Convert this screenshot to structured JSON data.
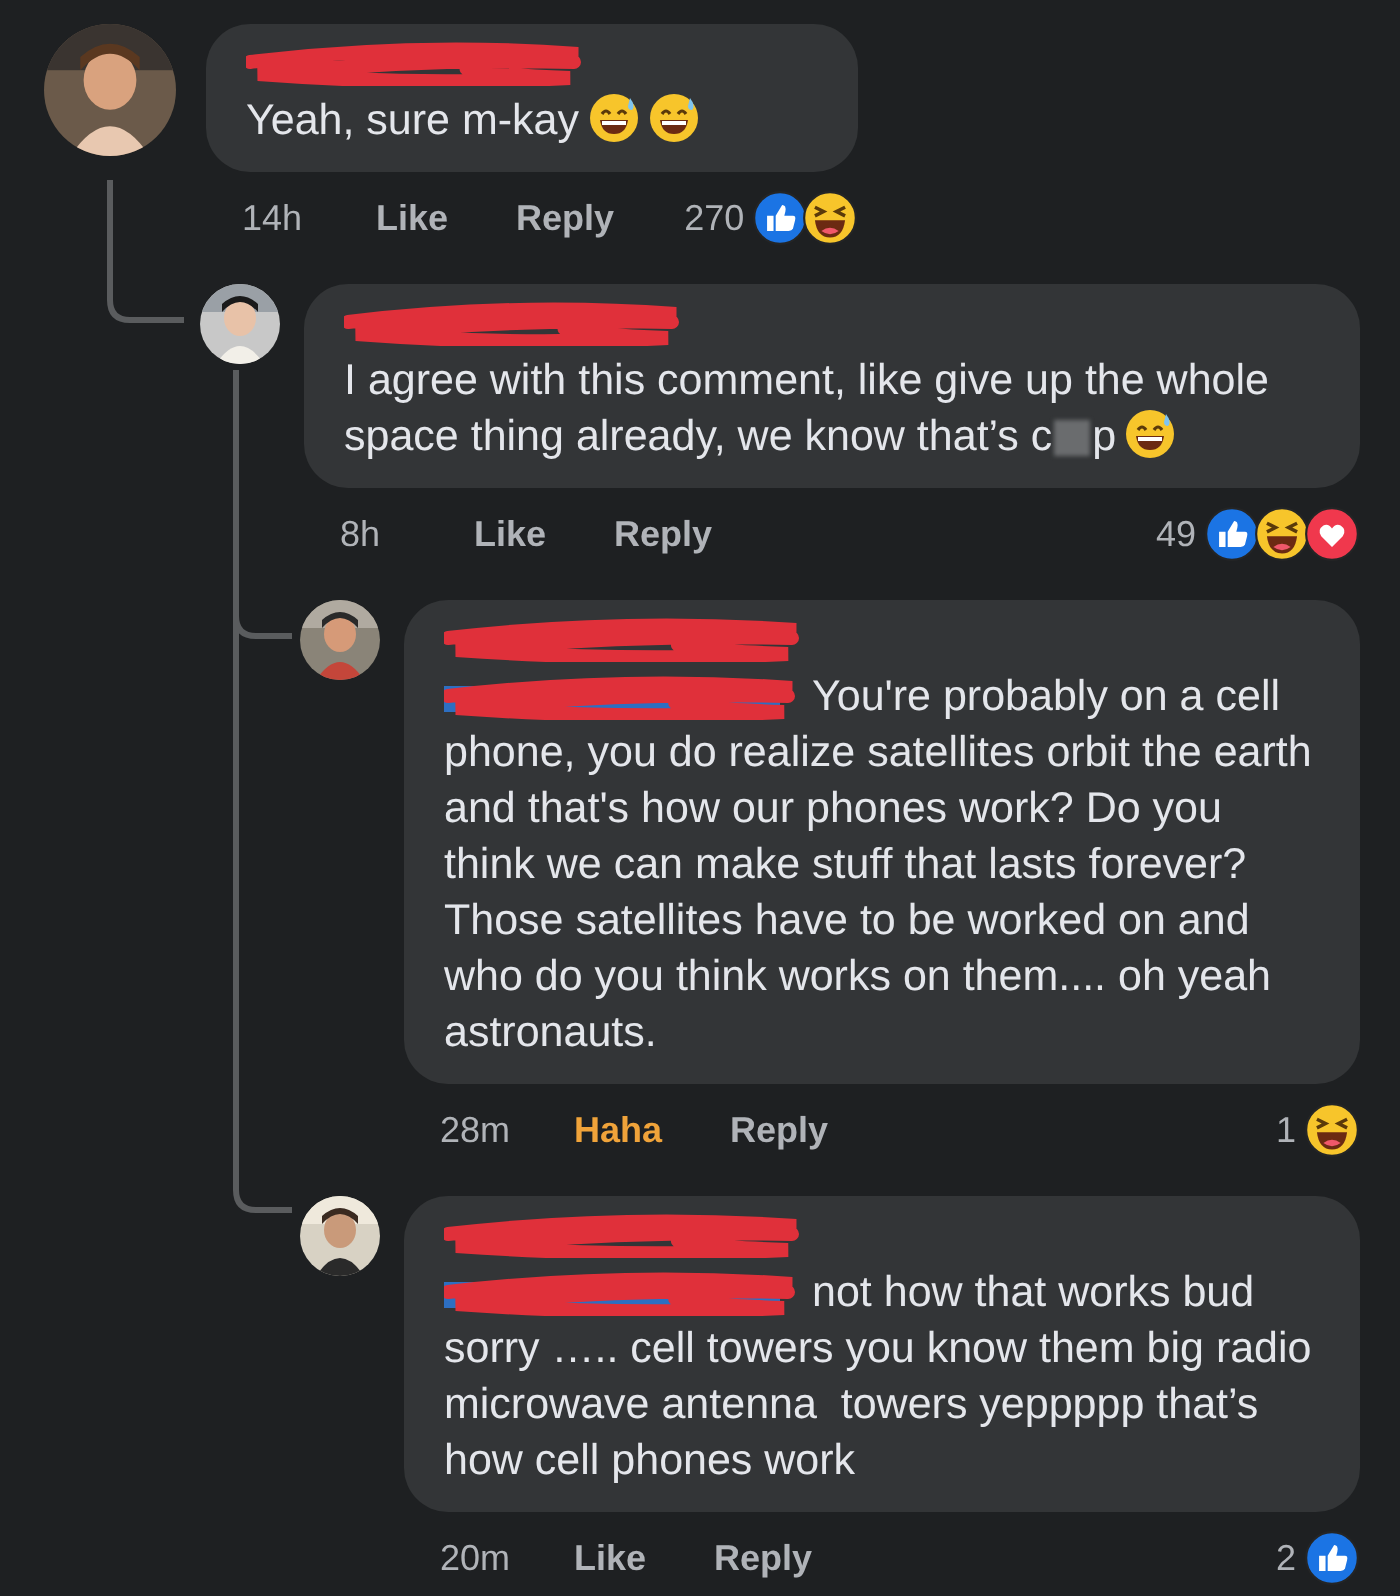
{
  "comments": [
    {
      "body": [
        {
          "kind": "text",
          "text": "Yeah, sure m-kay"
        },
        {
          "kind": "sweat-smile-emoji"
        },
        {
          "kind": "sweat-smile-emoji"
        }
      ],
      "time": "14h",
      "reaction_action": {
        "label": "Like",
        "selected": false
      },
      "reply": "Reply",
      "reaction_count": "270",
      "reactions": [
        {
          "kind": "like"
        },
        {
          "kind": "haha"
        }
      ],
      "children": [
        {
          "body": [
            {
              "kind": "text",
              "text": "I agree with this comment, like give up the whole space thing already, we know that’s c"
            },
            {
              "kind": "blur"
            },
            {
              "kind": "text",
              "text": "p"
            },
            {
              "kind": "sweat-smile-emoji"
            }
          ],
          "time": "8h",
          "reaction_action": {
            "label": "Like",
            "selected": false
          },
          "reply": "Reply",
          "reaction_count": "49",
          "reactions": [
            {
              "kind": "like"
            },
            {
              "kind": "haha"
            },
            {
              "kind": "love"
            }
          ],
          "children": [
            {
              "body": [
                {
                  "kind": "mention_redacted"
                },
                {
                  "kind": "text",
                  "text": "You're probably on a cell phone, you do realize satellites orbit the earth and that's how our phones work? Do you think we can make stuff that lasts forever? Those satellites have to be worked on and who do you think works on them.... oh yeah astronauts."
                }
              ],
              "time": "28m",
              "reaction_action": {
                "label": "Haha",
                "selected": true
              },
              "reply": "Reply",
              "reaction_count": "1",
              "reactions": [
                {
                  "kind": "haha"
                }
              ]
            },
            {
              "body": [
                {
                  "kind": "mention_redacted"
                },
                {
                  "kind": "text",
                  "text": "not how that works bud sorry ….. cell towers you know them big radio microwave antenna  towers yeppppp that’s how cell phones work"
                }
              ],
              "time": "20m",
              "reaction_action": {
                "label": "Like",
                "selected": false
              },
              "reply": "Reply",
              "reaction_count": "2",
              "reactions": [
                {
                  "kind": "like"
                }
              ]
            }
          ]
        }
      ]
    }
  ]
}
